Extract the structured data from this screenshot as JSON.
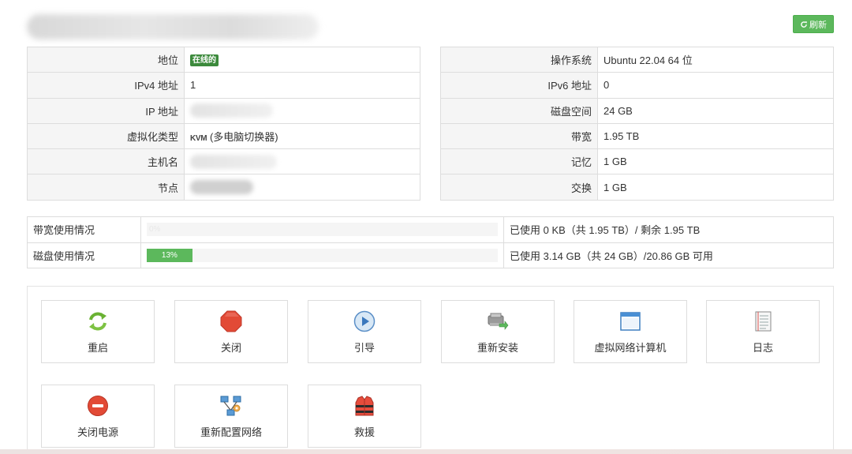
{
  "header": {
    "refresh_label": "刷新"
  },
  "info_left": [
    {
      "label": "地位",
      "value": "在线的",
      "type": "badge"
    },
    {
      "label": "IPv4 地址",
      "value": "1",
      "type": "text"
    },
    {
      "label": "IP 地址",
      "value": "",
      "type": "blurred"
    },
    {
      "label": "虚拟化类型",
      "value": "(多电脑切换器)",
      "type": "kvm",
      "logo": "KVM"
    },
    {
      "label": "主机名",
      "value": "",
      "type": "blurred"
    },
    {
      "label": "节点",
      "value": "",
      "type": "blurred"
    }
  ],
  "info_right": [
    {
      "label": "操作系统",
      "value": "Ubuntu 22.04 64 位"
    },
    {
      "label": "IPv6 地址",
      "value": "0"
    },
    {
      "label": "磁盘空间",
      "value": "24 GB"
    },
    {
      "label": "带宽",
      "value": "1.95 TB"
    },
    {
      "label": "记忆",
      "value": "1 GB"
    },
    {
      "label": "交换",
      "value": "1 GB"
    }
  ],
  "usage": [
    {
      "label": "带宽使用情况",
      "percent": 0,
      "percent_label": "0%",
      "detail": "已使用 0 KB（共 1.95 TB）/ 剩余 1.95 TB"
    },
    {
      "label": "磁盘使用情况",
      "percent": 13,
      "percent_label": "13%",
      "detail": "已使用 3.14 GB（共 24 GB）/20.86 GB 可用"
    }
  ],
  "actions": [
    {
      "label": "重启",
      "icon": "restart-icon"
    },
    {
      "label": "关闭",
      "icon": "stop-icon"
    },
    {
      "label": "引导",
      "icon": "boot-icon"
    },
    {
      "label": "重新安装",
      "icon": "reinstall-icon"
    },
    {
      "label": "虚拟网络计算机",
      "icon": "vnc-window-icon"
    },
    {
      "label": "日志",
      "icon": "log-icon"
    },
    {
      "label": "关闭电源",
      "icon": "power-off-icon"
    },
    {
      "label": "重新配置网络",
      "icon": "network-config-icon"
    },
    {
      "label": "救援",
      "icon": "rescue-icon"
    }
  ],
  "colors": {
    "accent_green": "#5cb85c",
    "badge_green": "#3c8a3c",
    "stop_red": "#e74c3c"
  }
}
